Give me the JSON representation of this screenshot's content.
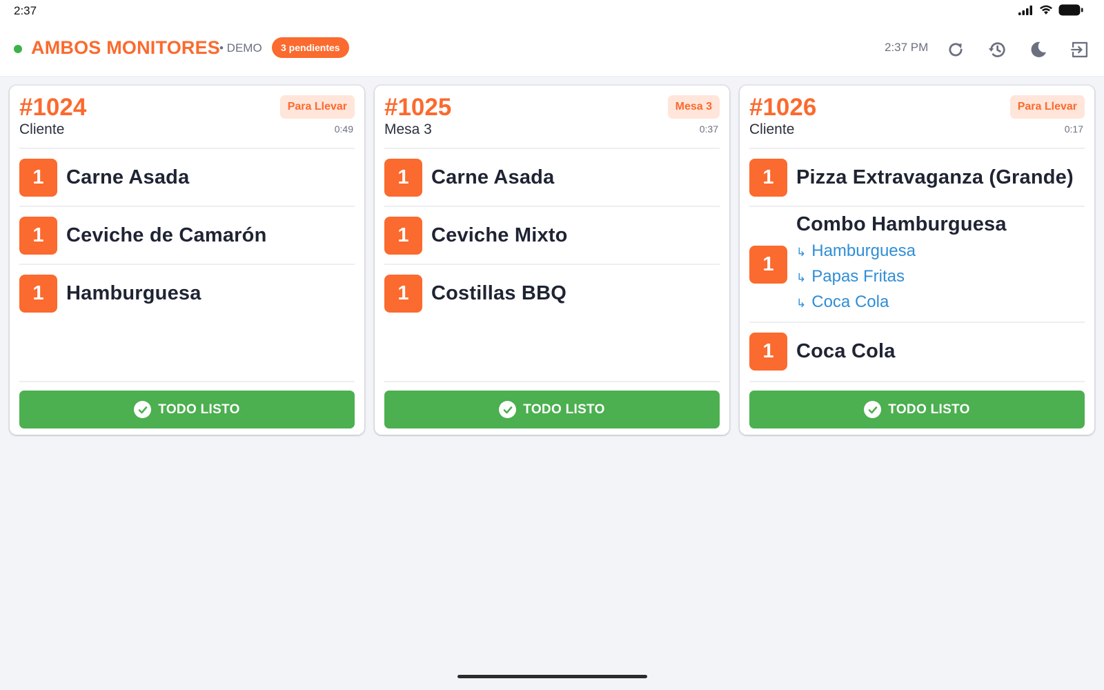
{
  "status_bar": {
    "time": "2:37"
  },
  "header": {
    "title": "AMBOS MONITORES",
    "mode": "• DEMO",
    "pending_badge": "3 pendientes",
    "clock": "2:37 PM",
    "icons": [
      "refresh-icon",
      "history-icon",
      "moon-icon",
      "logout-icon"
    ]
  },
  "colors": {
    "accent": "#fb6a2e",
    "success": "#4caf50",
    "modifier": "#2f8ed6",
    "live": "#3cb34a"
  },
  "orders": [
    {
      "number": "#1024",
      "customer": "Cliente",
      "type": "Para Llevar",
      "elapsed": "0:49",
      "items": [
        {
          "qty": "1",
          "name": "Carne Asada",
          "modifiers": []
        },
        {
          "qty": "1",
          "name": "Ceviche de Camarón",
          "modifiers": []
        },
        {
          "qty": "1",
          "name": "Hamburguesa",
          "modifiers": []
        }
      ],
      "action": "TODO LISTO"
    },
    {
      "number": "#1025",
      "customer": "Mesa 3",
      "type": "Mesa 3",
      "elapsed": "0:37",
      "items": [
        {
          "qty": "1",
          "name": "Carne Asada",
          "modifiers": []
        },
        {
          "qty": "1",
          "name": "Ceviche Mixto",
          "modifiers": []
        },
        {
          "qty": "1",
          "name": "Costillas BBQ",
          "modifiers": []
        }
      ],
      "action": "TODO LISTO"
    },
    {
      "number": "#1026",
      "customer": "Cliente",
      "type": "Para Llevar",
      "elapsed": "0:17",
      "items": [
        {
          "qty": "1",
          "name": "Pizza Extravaganza (Grande)",
          "modifiers": []
        },
        {
          "qty": "1",
          "name": "Combo Hamburguesa",
          "modifiers": [
            "Hamburguesa",
            "Papas Fritas",
            "Coca Cola"
          ]
        },
        {
          "qty": "1",
          "name": "Coca Cola",
          "modifiers": []
        }
      ],
      "action": "TODO LISTO"
    }
  ],
  "modifier_arrow": "↳"
}
